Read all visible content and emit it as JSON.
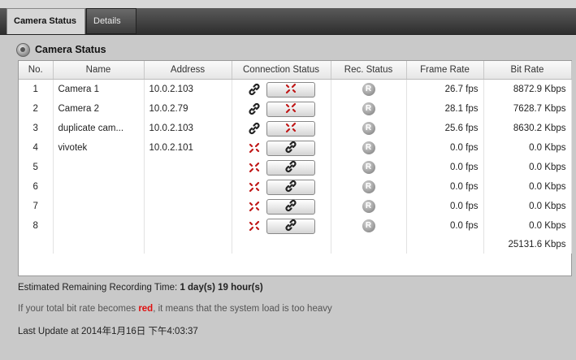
{
  "tabs": [
    {
      "label": "Camera Status"
    },
    {
      "label": "Details"
    }
  ],
  "section": {
    "title": "Camera Status",
    "icon": "camera-icon"
  },
  "table": {
    "headers": [
      "No.",
      "Name",
      "Address",
      "Connection Status",
      "Rec. Status",
      "Frame Rate",
      "Bit Rate"
    ],
    "rows": [
      {
        "no": "1",
        "name": "Camera 1",
        "address": "10.0.2.103",
        "connected": true,
        "frame_rate": "26.7 fps",
        "bit_rate": "8872.9 Kbps"
      },
      {
        "no": "2",
        "name": "Camera 2",
        "address": "10.0.2.79",
        "connected": true,
        "frame_rate": "28.1 fps",
        "bit_rate": "7628.7 Kbps"
      },
      {
        "no": "3",
        "name": "duplicate cam...",
        "address": "10.0.2.103",
        "connected": true,
        "frame_rate": "25.6 fps",
        "bit_rate": "8630.2 Kbps"
      },
      {
        "no": "4",
        "name": "vivotek",
        "address": "10.0.2.101",
        "connected": false,
        "frame_rate": "0.0 fps",
        "bit_rate": "0.0 Kbps"
      },
      {
        "no": "5",
        "name": "",
        "address": "",
        "connected": false,
        "frame_rate": "0.0 fps",
        "bit_rate": "0.0 Kbps"
      },
      {
        "no": "6",
        "name": "",
        "address": "",
        "connected": false,
        "frame_rate": "0.0 fps",
        "bit_rate": "0.0 Kbps"
      },
      {
        "no": "7",
        "name": "",
        "address": "",
        "connected": false,
        "frame_rate": "0.0 fps",
        "bit_rate": "0.0 Kbps"
      },
      {
        "no": "8",
        "name": "",
        "address": "",
        "connected": false,
        "frame_rate": "0.0 fps",
        "bit_rate": "0.0 Kbps"
      }
    ],
    "rec_label": "R",
    "total_bit_rate": "25131.6 Kbps"
  },
  "footer": {
    "remaining_label": "Estimated Remaining Recording Time:",
    "remaining_value": "1 day(s) 19 hour(s)",
    "warning_prefix": "If your total bit rate becomes",
    "warning_red": "red",
    "warning_suffix": ", it means that the system load is too heavy",
    "last_update": "Last Update at 2014年1月16日 下午4:03:37"
  },
  "colors": {
    "link_active": "#222222",
    "link_broken": "#c01818",
    "warning_red": "#e01010"
  }
}
